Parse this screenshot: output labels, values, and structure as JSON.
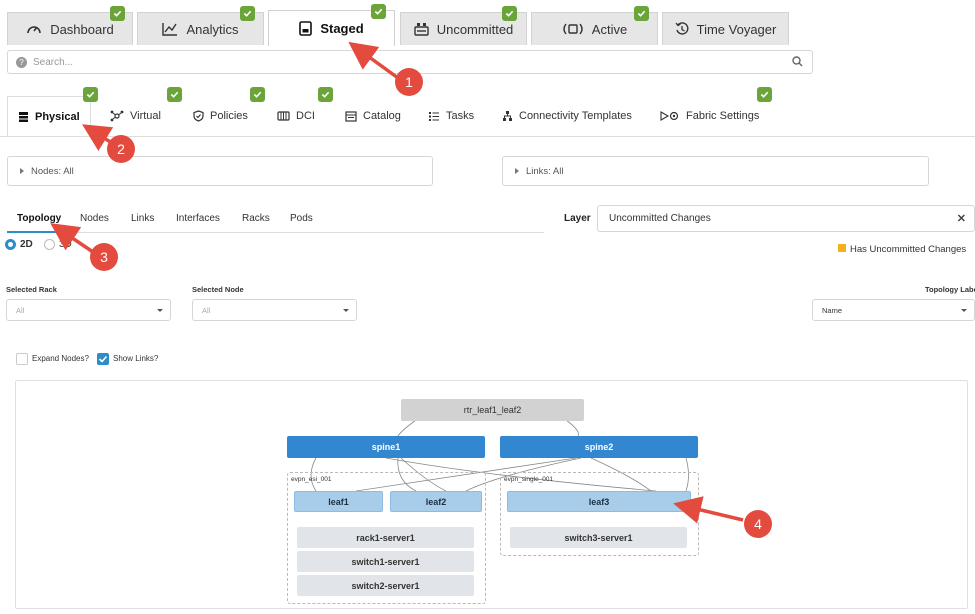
{
  "top_tabs": [
    {
      "label": "Dashboard",
      "icon": "gauge-icon",
      "status": "ok"
    },
    {
      "label": "Analytics",
      "icon": "line-chart-icon",
      "status": "ok"
    },
    {
      "label": "Staged",
      "icon": "document-icon",
      "status": "ok",
      "active": true
    },
    {
      "label": "Uncommitted",
      "icon": "uncommitted-icon",
      "status": "ok"
    },
    {
      "label": "Active",
      "icon": "active-icon",
      "status": "ok"
    },
    {
      "label": "Time Voyager",
      "icon": "history-icon"
    }
  ],
  "search": {
    "placeholder": "Search..."
  },
  "sub_tabs": [
    {
      "label": "Physical",
      "icon": "server-icon",
      "status": "ok",
      "active": true
    },
    {
      "label": "Virtual",
      "icon": "virtual-network-icon",
      "status": "ok"
    },
    {
      "label": "Policies",
      "icon": "shield-icon",
      "status": "ok"
    },
    {
      "label": "DCI",
      "icon": "dci-icon",
      "status": "ok"
    },
    {
      "label": "Catalog",
      "icon": "catalog-icon"
    },
    {
      "label": "Tasks",
      "icon": "tasks-icon"
    },
    {
      "label": "Connectivity Templates",
      "icon": "connectivity-icon"
    },
    {
      "label": "Fabric Settings",
      "icon": "fabric-settings-icon",
      "status": "ok"
    }
  ],
  "filters": {
    "nodes": "Nodes: All",
    "links": "Links: All"
  },
  "topology_tabs": [
    "Topology",
    "Nodes",
    "Links",
    "Interfaces",
    "Racks",
    "Pods"
  ],
  "layer": {
    "label": "Layer",
    "value": "Uncommitted Changes"
  },
  "view_modes": {
    "two_d": "2D",
    "three_d": "3D",
    "selected": "2D"
  },
  "legend": {
    "label": "Has Uncommitted Changes",
    "color": "#f2b21b"
  },
  "selectors": {
    "rack": {
      "label": "Selected Rack",
      "value": "All"
    },
    "node": {
      "label": "Selected Node",
      "value": "All"
    },
    "topology_label": {
      "label": "Topology Labe",
      "value": "Name"
    }
  },
  "options": {
    "expand_nodes": "Expand Nodes?",
    "expand_nodes_checked": false,
    "show_links": "Show Links?",
    "show_links_checked": true
  },
  "topology": {
    "external": "rtr_leaf1_leaf2",
    "spines": [
      "spine1",
      "spine2"
    ],
    "groups": [
      {
        "name": "evpn_esi_001",
        "leaves": [
          "leaf1",
          "leaf2"
        ],
        "servers": [
          "rack1-server1",
          "switch1-server1",
          "switch2-server1"
        ]
      },
      {
        "name": "evpn_single_001",
        "leaves": [
          "leaf3"
        ],
        "servers": [
          "switch3-server1"
        ]
      }
    ]
  },
  "callouts": [
    "1",
    "2",
    "3",
    "4"
  ],
  "colors": {
    "accent": "#2c8ec6",
    "ok_badge": "#6ba539",
    "spine": "#3386d0",
    "leaf": "#a7cdeb",
    "callout": "#e34b3f"
  }
}
